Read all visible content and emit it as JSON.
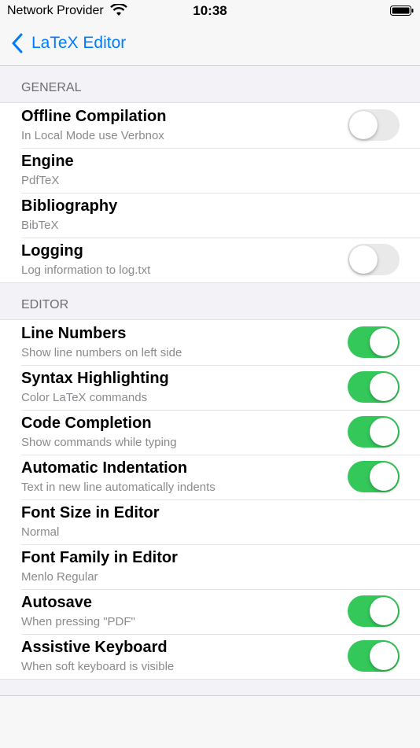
{
  "status_bar": {
    "carrier": "Network Provider",
    "time": "10:38"
  },
  "nav": {
    "back_label": "LaTeX Editor"
  },
  "sections": [
    {
      "header": "GENERAL",
      "rows": [
        {
          "title": "Offline Compilation",
          "subtitle": "In Local Mode use Verbnox",
          "toggle": "off"
        },
        {
          "title": "Engine",
          "subtitle": "PdfTeX"
        },
        {
          "title": "Bibliography",
          "subtitle": "BibTeX"
        },
        {
          "title": "Logging",
          "subtitle": "Log information to log.txt",
          "toggle": "off"
        }
      ]
    },
    {
      "header": "EDITOR",
      "rows": [
        {
          "title": "Line Numbers",
          "subtitle": "Show line numbers on left side",
          "toggle": "on"
        },
        {
          "title": "Syntax Highlighting",
          "subtitle": "Color LaTeX commands",
          "toggle": "on"
        },
        {
          "title": "Code Completion",
          "subtitle": "Show commands while typing",
          "toggle": "on"
        },
        {
          "title": "Automatic Indentation",
          "subtitle": "Text in new line automatically indents",
          "toggle": "on"
        },
        {
          "title": "Font Size in Editor",
          "subtitle": "Normal"
        },
        {
          "title": "Font Family in Editor",
          "subtitle": "Menlo Regular"
        },
        {
          "title": "Autosave",
          "subtitle": "When pressing \"PDF\"",
          "toggle": "on"
        },
        {
          "title": "Assistive Keyboard",
          "subtitle": "When soft keyboard is visible",
          "toggle": "on"
        }
      ]
    }
  ],
  "colors": {
    "accent": "#007aff",
    "toggle_on": "#34c759",
    "toggle_off": "#e9e9ea"
  }
}
